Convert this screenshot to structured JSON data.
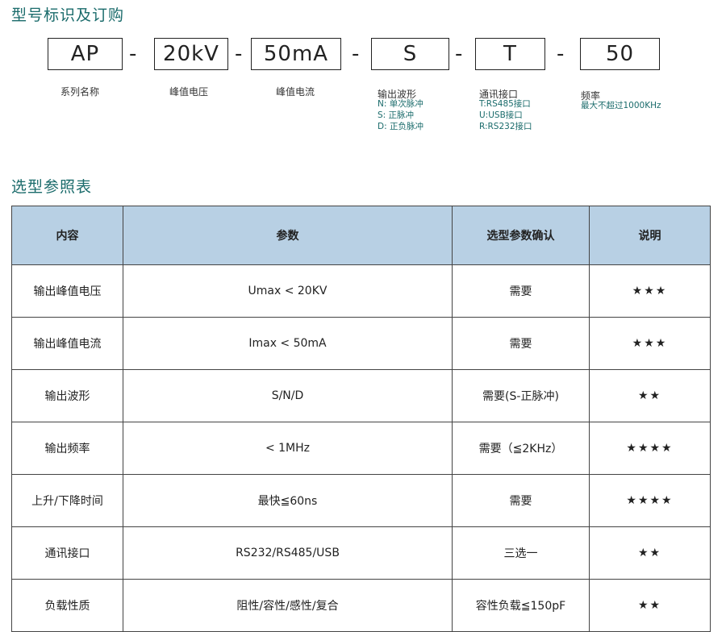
{
  "section1": {
    "title": "型号标识及订购",
    "segments": [
      {
        "code": "AP",
        "label": "系列名称",
        "desc": []
      },
      {
        "code": "20kV",
        "label": "峰值电压",
        "desc": []
      },
      {
        "code": "50mA",
        "label": "峰值电流",
        "desc": []
      },
      {
        "code": "S",
        "label": "输出波形",
        "desc": [
          "N:  单次脉冲",
          "S:  正脉冲",
          "D:  正负脉冲"
        ]
      },
      {
        "code": "T",
        "label": "通讯接口",
        "desc": [
          "T:RS485接口",
          "U:USB接口",
          "R:RS232接口"
        ]
      },
      {
        "code": "50",
        "label": "频率",
        "desc": [
          "最大不超过1000KHz"
        ]
      }
    ],
    "separator": "-"
  },
  "section2": {
    "title": "选型参照表",
    "headers": [
      "内容",
      "参数",
      "选型参数确认",
      "说明"
    ],
    "rows": [
      [
        "输出峰值电压",
        "Umax < 20KV",
        "需要",
        "★★★"
      ],
      [
        "输出峰值电流",
        "Imax < 50mA",
        "需要",
        "★★★"
      ],
      [
        "输出波形",
        "S/N/D",
        "需要(S-正脉冲)",
        "★★"
      ],
      [
        "输出频率",
        "< 1MHz",
        "需要（≦2KHz）",
        "★★★★"
      ],
      [
        "上升/下降时间",
        "最快≦60ns",
        "需要",
        "★★★★"
      ],
      [
        "通讯接口",
        "RS232/RS485/USB",
        "三选一",
        "★★"
      ],
      [
        "负载性质",
        "阻性/容性/感性/复合",
        "容性负载≦150pF",
        "★★"
      ]
    ]
  }
}
